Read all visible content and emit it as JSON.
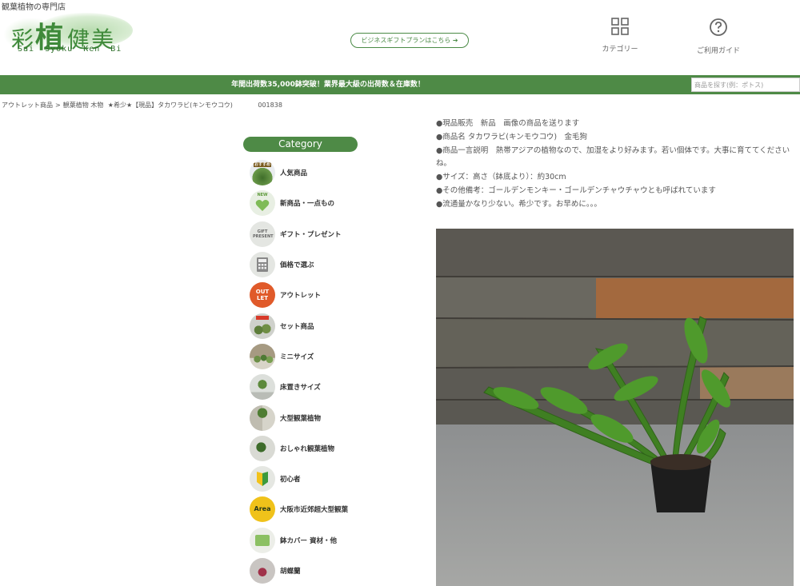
{
  "header": {
    "tagline": "観葉植物の専門店",
    "logo_kanji": [
      "彩",
      "植",
      "健",
      "美"
    ],
    "logo_roman": "Sai  Syoku  Ken  Bi",
    "business_button": "ビジネスギフトプランはこちら ➔",
    "nav": {
      "category_label": "カテゴリー",
      "guide_label": "ご利用ガイド"
    }
  },
  "banner": {
    "text": "年間出荷数35,000鉢突破！業界最大級の出荷数＆在庫数！",
    "search_placeholder": "商品を探す(例：ポトス)"
  },
  "breadcrumb": {
    "items": [
      "アウトレット商品",
      ">",
      "観葉植物 木物",
      "★希少★【現品】タカワラビ(キンモウコウ)"
    ],
    "code": "001838"
  },
  "sidebar": {
    "heading": "Category",
    "items": [
      {
        "label": "人気商品",
        "icon": "popular-plant-icon",
        "color": "#5e7f3c",
        "badge": "おすすめ"
      },
      {
        "label": "新商品・一点もの",
        "icon": "new-heart-icon",
        "color": "#8dc06b",
        "badge": "NEW"
      },
      {
        "label": "ギフト・プレゼント",
        "icon": "gift-icon",
        "color": "#dfe2dd",
        "badge": "GIFT PRESENT"
      },
      {
        "label": "価格で選ぶ",
        "icon": "calculator-icon",
        "color": "#dfe2dd",
        "badge": ""
      },
      {
        "label": "アウトレット",
        "icon": "outlet-icon",
        "color": "#e05a2a",
        "badge": "OUT LET"
      },
      {
        "label": "セット商品",
        "icon": "set-plants-icon",
        "color": "#c9cbc6",
        "badge": ""
      },
      {
        "label": "ミニサイズ",
        "icon": "mini-plants-icon",
        "color": "#b6b3a4",
        "badge": ""
      },
      {
        "label": "床置きサイズ",
        "icon": "floor-plant-icon",
        "color": "#c7c9c3",
        "badge": ""
      },
      {
        "label": "大型観葉植物",
        "icon": "large-plant-icon",
        "color": "#c4c3b8",
        "badge": ""
      },
      {
        "label": "おしゃれ観葉植物",
        "icon": "stylish-plant-icon",
        "color": "#d3d4cd",
        "badge": ""
      },
      {
        "label": "初心者",
        "icon": "beginner-mark-icon",
        "color": "#e3e5e0",
        "badge": ""
      },
      {
        "label": "大阪市近郊超大型観葉",
        "icon": "area-icon",
        "color": "#f0c21a",
        "badge": "Area"
      },
      {
        "label": "鉢カバー 資材・他",
        "icon": "pot-cover-icon",
        "color": "#e7eadf",
        "badge": ""
      },
      {
        "label": "胡蝶蘭",
        "icon": "orchid-icon",
        "color": "#b8b3b0",
        "badge": ""
      }
    ]
  },
  "product": {
    "lines": [
      "●現品販売　新品　画像の商品を送ります",
      "●商品名 タカワラビ(キンモウコウ)　金毛狗",
      "●商品一言説明　熱帯アジアの植物なので、加湿をより好みます。若い個体です。大事に育ててください ね。",
      "●サイズ：高さ（鉢底より）：約30cm",
      "●その他備考：ゴールデンモンキー・ゴールデンチャウチャウとも呼ばれています",
      "●流通量かなり少ない。希少です。お早めに。。。"
    ]
  },
  "colors": {
    "brand_green": "#4e8a46",
    "logo_green": "#3f8a3a"
  }
}
